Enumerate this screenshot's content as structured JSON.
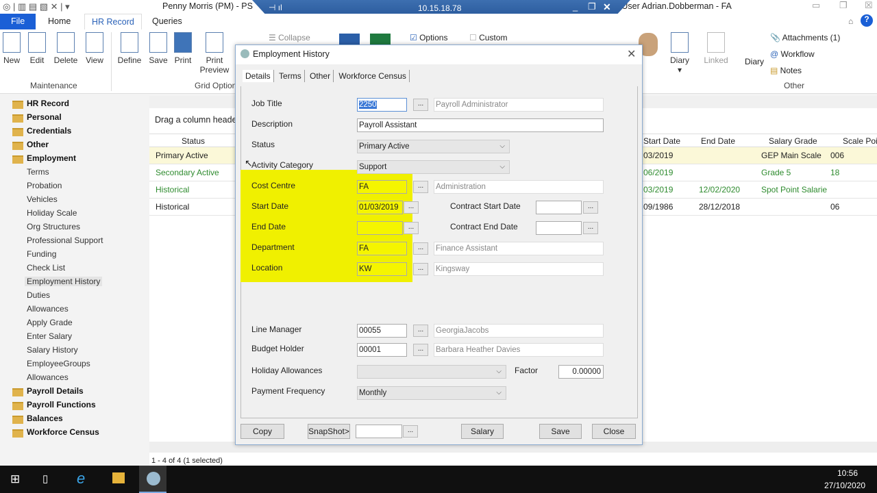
{
  "window": {
    "title": "Penny Morris (PM) - PS",
    "title_right": "air User Adrian.Dobberman - FA"
  },
  "remote": {
    "ip": "10.15.18.78"
  },
  "ribbon_tabs": [
    "File",
    "Home",
    "HR Record",
    "Queries"
  ],
  "ribbon": {
    "maintenance": [
      "New",
      "Edit",
      "Delete",
      "View"
    ],
    "maintenance_label": "Maintenance",
    "grid": [
      "Define",
      "Save",
      "Print",
      "Print Preview"
    ],
    "grid_label": "Grid Options",
    "collapse": "Collapse",
    "options": "Options",
    "custom": "Custom",
    "diary": "Diary",
    "linked": "Linked",
    "diary2": "Diary",
    "attachments": "Attachments (1)",
    "workflow": "Workflow",
    "notes": "Notes",
    "other_label": "Other"
  },
  "sidebar": [
    {
      "label": "HR Record",
      "bold": true
    },
    {
      "label": "Personal",
      "bold": true
    },
    {
      "label": "Credentials",
      "bold": true
    },
    {
      "label": "Other",
      "bold": true
    },
    {
      "label": "Employment",
      "bold": true
    },
    {
      "label": "Terms"
    },
    {
      "label": "Probation"
    },
    {
      "label": "Vehicles"
    },
    {
      "label": "Holiday Scale"
    },
    {
      "label": "Org Structures"
    },
    {
      "label": "Professional Support"
    },
    {
      "label": "Funding"
    },
    {
      "label": "Check List"
    },
    {
      "label": "Employment History",
      "selected": true
    },
    {
      "label": "Duties"
    },
    {
      "label": "Allowances"
    },
    {
      "label": "Apply Grade"
    },
    {
      "label": "Enter Salary"
    },
    {
      "label": "Salary History"
    },
    {
      "label": "EmployeeGroups"
    },
    {
      "label": "Allowances"
    },
    {
      "label": "Payroll Details",
      "bold": true
    },
    {
      "label": "Payroll Functions",
      "bold": true
    },
    {
      "label": "Balances",
      "bold": true
    },
    {
      "label": "Workforce Census",
      "bold": true
    }
  ],
  "grid": {
    "drag_hint": "Drag a column heade",
    "headers": {
      "status": "Status",
      "start": "Start Date",
      "end": "End Date",
      "grade": "Salary Grade",
      "point": "Scale Poin"
    },
    "rows": [
      {
        "status": "Primary Active",
        "start": "03/2019",
        "end": "",
        "grade": "GEP Main Scale",
        "point": "006",
        "color": "#222",
        "selected": true
      },
      {
        "status": "Secondary Active",
        "start": "06/2019",
        "end": "",
        "grade": "Grade 5",
        "point": "18",
        "color": "#2e8b2e"
      },
      {
        "status": "Historical",
        "start": "03/2019",
        "end": "12/02/2020",
        "grade": "Spot Point Salarie",
        "point": "",
        "color": "#2e8b2e"
      },
      {
        "status": "Historical",
        "start": "09/1986",
        "end": "28/12/2018",
        "grade": "",
        "point": "06",
        "color": "#222"
      }
    ],
    "footer": "1 - 4 of 4 (1 selected)"
  },
  "dialog": {
    "title": "Employment History",
    "tabs": [
      "Details",
      "Terms",
      "Other",
      "Workforce Census"
    ],
    "job_title": {
      "label": "Job Title",
      "code": "2250",
      "desc": "Payroll Administrator"
    },
    "description": {
      "label": "Description",
      "value": "Payroll Assistant"
    },
    "status": {
      "label": "Status",
      "value": "Primary Active"
    },
    "activity": {
      "label": "Activity Category",
      "value": "Support"
    },
    "cost_centre": {
      "label": "Cost Centre",
      "code": "FA",
      "desc": "Administration"
    },
    "start_date": {
      "label": "Start Date",
      "value": "01/03/2019"
    },
    "end_date": {
      "label": "End Date",
      "value": ""
    },
    "contract_start": {
      "label": "Contract Start Date",
      "value": ""
    },
    "contract_end": {
      "label": "Contract End Date",
      "value": ""
    },
    "department": {
      "label": "Department",
      "code": "FA",
      "desc": "Finance Assistant"
    },
    "location": {
      "label": "Location",
      "code": "KW",
      "desc": "Kingsway"
    },
    "line_manager": {
      "label": "Line Manager",
      "code": "00055",
      "desc": "GeorgiaJacobs"
    },
    "budget_holder": {
      "label": "Budget Holder",
      "code": "00001",
      "desc": "Barbara Heather Davies"
    },
    "holiday": {
      "label": "Holiday Allowances",
      "value": ""
    },
    "factor": {
      "label": "Factor",
      "value": "0.00000"
    },
    "payment": {
      "label": "Payment Frequency",
      "value": "Monthly"
    },
    "buttons": {
      "copy": "Copy",
      "snapshot": "SnapShot>",
      "salary": "Salary",
      "save": "Save",
      "close": "Close"
    },
    "dots": "..."
  },
  "taskbar": {
    "time": "10:56",
    "date": "27/10/2020"
  },
  "colors": {
    "highlight": "#f0f000",
    "file_tab": "#1a5fd6",
    "selected_row": "#fbf8d8"
  }
}
